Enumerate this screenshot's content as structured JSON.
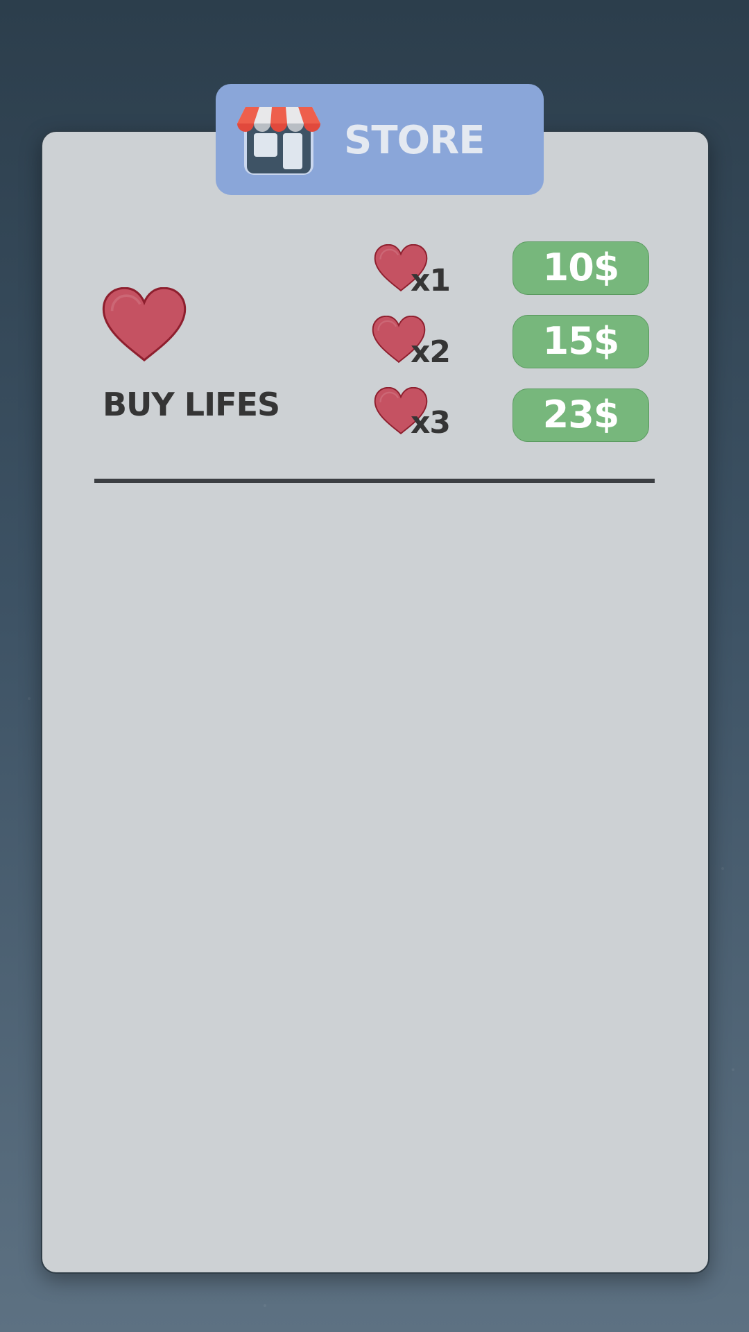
{
  "store": {
    "title": "STORE",
    "icon": "store-icon"
  },
  "lives": {
    "label": "BUY LIFES",
    "icon": "heart-icon",
    "offers": [
      {
        "quantity": "x1",
        "price": "10$"
      },
      {
        "quantity": "x2",
        "price": "15$"
      },
      {
        "quantity": "x3",
        "price": "23$"
      }
    ]
  },
  "colors": {
    "panel": "#cdd1d4",
    "tab": "#8aa6d9",
    "button": "#77b77c",
    "heart": "#c55262"
  }
}
